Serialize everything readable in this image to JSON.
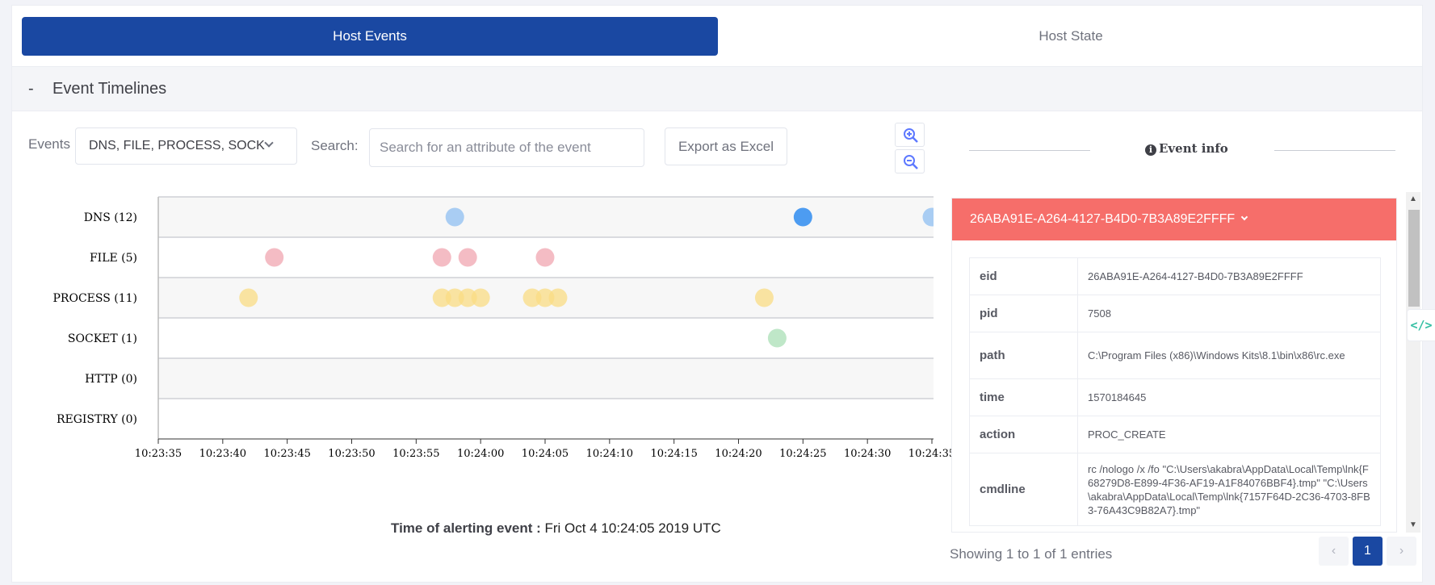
{
  "tabs": [
    {
      "label": "Host Events",
      "active": true
    },
    {
      "label": "Host State",
      "active": false
    }
  ],
  "section": {
    "title": "Event Timelines",
    "toggle": "-"
  },
  "filters": {
    "events_label": "Events",
    "events_value": "DNS, FILE, PROCESS, SOCK",
    "search_label": "Search:",
    "search_placeholder": "Search for an attribute of the event",
    "export_label": "Export as Excel"
  },
  "chart_data": {
    "type": "scatter",
    "rows": [
      {
        "label": "DNS (12)",
        "color": "#8fbff2",
        "events": [
          "10:23:58",
          "10:24:25",
          "10:24:35"
        ]
      },
      {
        "label": "FILE (5)",
        "color": "#f0a6b0",
        "events": [
          "10:23:44",
          "10:23:57",
          "10:23:59",
          "10:24:05"
        ]
      },
      {
        "label": "PROCESS (11)",
        "color": "#f9dc84",
        "events": [
          "10:23:42",
          "10:23:57",
          "10:23:58",
          "10:23:59",
          "10:24:00",
          "10:24:04",
          "10:24:05",
          "10:24:06",
          "10:24:22"
        ]
      },
      {
        "label": "SOCKET (1)",
        "color": "#a9dfb6",
        "events": [
          "10:24:23"
        ]
      },
      {
        "label": "HTTP (0)",
        "color": "#cccccc",
        "events": []
      },
      {
        "label": "REGISTRY (0)",
        "color": "#cccccc",
        "events": []
      }
    ],
    "x_ticks": [
      "10:23:35",
      "10:23:40",
      "10:23:45",
      "10:23:50",
      "10:23:55",
      "10:24:00",
      "10:24:05",
      "10:24:10",
      "10:24:15",
      "10:24:20",
      "10:24:25",
      "10:24:30",
      "10:24:35"
    ],
    "x_range": [
      "10:23:35",
      "10:24:35"
    ],
    "highlighted_event": "10:24:25"
  },
  "alert": {
    "label": "Time of alerting event :",
    "value": "Fri Oct 4 10:24:05 2019 UTC"
  },
  "event_info": {
    "title": "Event info",
    "id": "26ABA91E-A264-4127-B4D0-7B3A89E2FFFF",
    "fields": [
      {
        "key": "eid",
        "value": "26ABA91E-A264-4127-B4D0-7B3A89E2FFFF"
      },
      {
        "key": "pid",
        "value": "7508"
      },
      {
        "key": "path",
        "value": "C:\\Program Files (x86)\\Windows Kits\\8.1\\bin\\x86\\rc.exe"
      },
      {
        "key": "time",
        "value": "1570184645"
      },
      {
        "key": "action",
        "value": "PROC_CREATE"
      },
      {
        "key": "cmdline",
        "value": "rc /nologo /x /fo \"C:\\Users\\akabra\\AppData\\Local\\Temp\\lnk{F68279D8-E899-4F36-AF19-A1F84076BBF4}.tmp\" \"C:\\Users\\akabra\\AppData\\Local\\Temp\\lnk{7157F64D-2C36-4703-8FB3-76A43C9B82A7}.tmp\""
      }
    ]
  },
  "pagination": {
    "summary": "Showing 1 to 1 of 1 entries",
    "prev": "‹",
    "current": "1",
    "next": "›"
  },
  "colors": {
    "primary": "#1a48a2",
    "card_header": "#f66e6a",
    "accent": "#34bfa3"
  }
}
